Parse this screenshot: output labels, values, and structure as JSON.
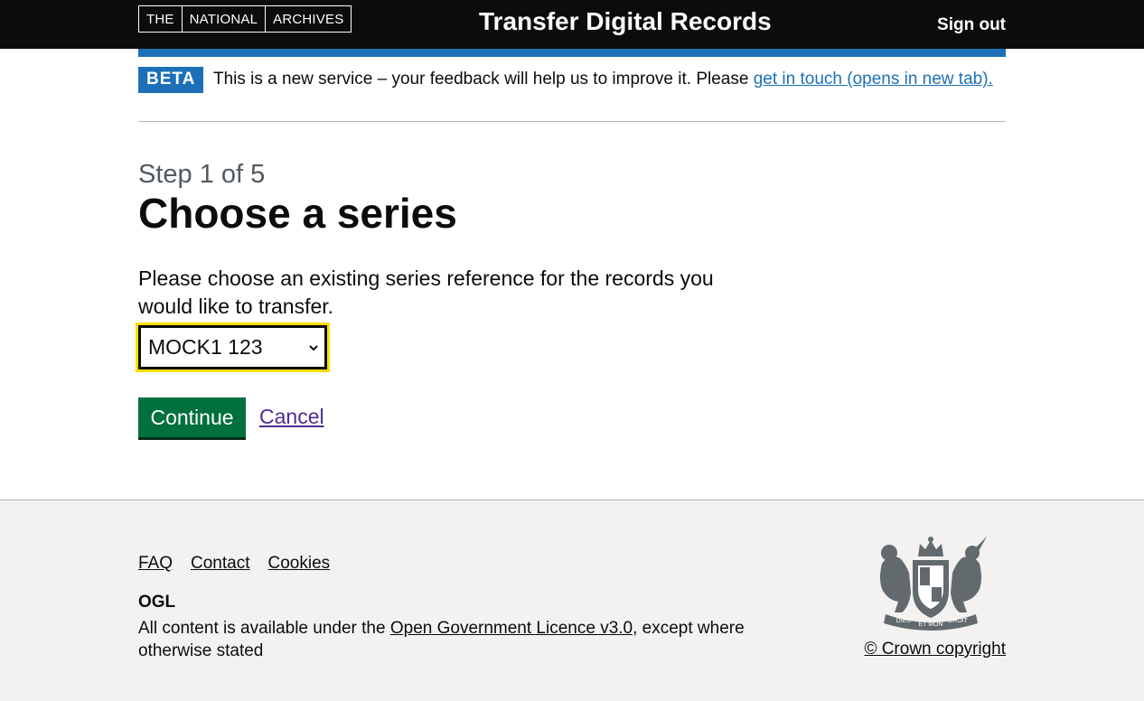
{
  "header": {
    "logo_parts": [
      "THE",
      "NATIONAL",
      "ARCHIVES"
    ],
    "service_name": "Transfer Digital Records",
    "sign_out_label": "Sign out"
  },
  "phase_banner": {
    "tag": "BETA",
    "text": "This is a new service – your feedback will help us to improve it. Please ",
    "link_text": "get in touch (opens in new tab)."
  },
  "main": {
    "caption": "Step 1 of 5",
    "heading": "Choose a series",
    "label": "Please choose an existing series reference for the records you would like to transfer.",
    "select": {
      "selected_value": "MOCK1 123"
    },
    "continue_label": "Continue",
    "cancel_label": "Cancel"
  },
  "footer": {
    "links": [
      "FAQ",
      "Contact",
      "Cookies"
    ],
    "ogl_logo_text": "OGL",
    "licence_prefix": "All content is available under the ",
    "licence_link": "Open Government Licence v3.0",
    "licence_suffix": ", except where otherwise stated",
    "crest_icon": "royal-coat-of-arms-icon",
    "crest_motto": [
      "DIEU",
      "ET MON",
      "DROIT"
    ],
    "copyright": "© Crown copyright"
  },
  "colors": {
    "header_bg": "#0b0c0c",
    "brand_blue": "#1d70b8",
    "button_green": "#00703c",
    "focus_yellow": "#ffdd00",
    "visited_link": "#4c2c92",
    "footer_bg": "#f3f2f1"
  }
}
